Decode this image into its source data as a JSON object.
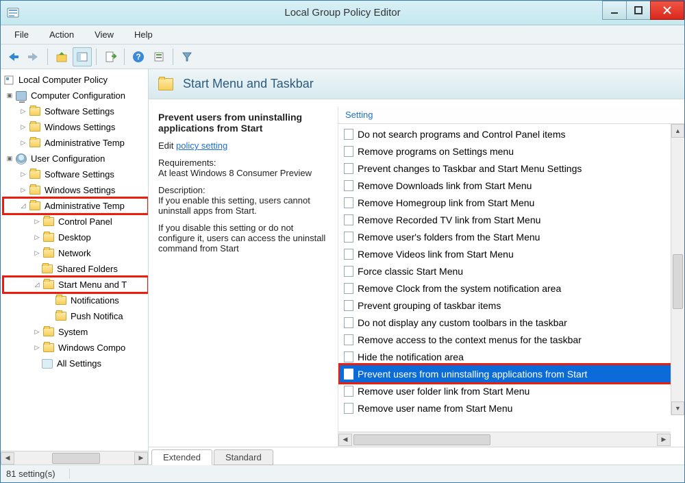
{
  "window": {
    "title": "Local Group Policy Editor"
  },
  "menu": {
    "file": "File",
    "action": "Action",
    "view": "View",
    "help": "Help"
  },
  "tree": {
    "root": "Local Computer Policy",
    "compConf": "Computer Configuration",
    "cc_soft": "Software Settings",
    "cc_win": "Windows Settings",
    "cc_admin": "Administrative Temp",
    "userConf": "User Configuration",
    "uc_soft": "Software Settings",
    "uc_win": "Windows Settings",
    "uc_admin": "Administrative Temp",
    "cp": "Control Panel",
    "desktop": "Desktop",
    "network": "Network",
    "shared": "Shared Folders",
    "start": "Start Menu and T",
    "notif": "Notifications",
    "push": "Push Notifica",
    "system": "System",
    "wcomp": "Windows Compo",
    "allset": "All Settings"
  },
  "header": {
    "title": "Start Menu and Taskbar"
  },
  "desc": {
    "title": "Prevent users from uninstalling applications from Start",
    "edit_prefix": "Edit",
    "edit_link": "policy setting",
    "req_label": "Requirements:",
    "req_text": "At least Windows 8 Consumer Preview",
    "desc_label": "Description:",
    "desc_text1": "If you enable this setting, users cannot uninstall apps from Start.",
    "desc_text2": "If you disable this setting or do not configure it, users can access the uninstall command from Start"
  },
  "list": {
    "header": "Setting",
    "items": [
      "Do not search programs and Control Panel items",
      "Remove programs on Settings menu",
      "Prevent changes to Taskbar and Start Menu Settings",
      "Remove Downloads link from Start Menu",
      "Remove Homegroup link from Start Menu",
      "Remove Recorded TV link from Start Menu",
      "Remove user's folders from the Start Menu",
      "Remove Videos link from Start Menu",
      "Force classic Start Menu",
      "Remove Clock from the system notification area",
      "Prevent grouping of taskbar items",
      "Do not display any custom toolbars in the taskbar",
      "Remove access to the context menus for the taskbar",
      "Hide the notification area",
      "Prevent users from uninstalling applications from Start",
      "Remove user folder link from Start Menu",
      "Remove user name from Start Menu"
    ],
    "selected_index": 14
  },
  "tabs": {
    "extended": "Extended",
    "standard": "Standard"
  },
  "status": {
    "text": "81 setting(s)"
  }
}
